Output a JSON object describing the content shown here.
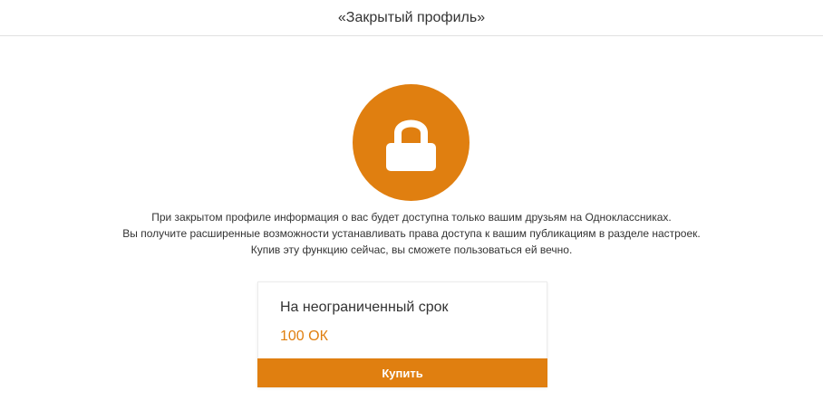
{
  "header": {
    "title": "«Закрытый профиль»"
  },
  "lock": {
    "icon": "lock-icon",
    "color": "#e07f10"
  },
  "description": {
    "lines": [
      "При закрытом профиле информация о вас будет доступна только вашим друзьям на Одноклассниках.",
      "Вы получите расширенные возможности устанавливать права доступа к вашим публикациям в разделе настроек.",
      "Купив эту функцию сейчас, вы сможете пользоваться ей вечно."
    ]
  },
  "offer": {
    "term": "На неограниченный срок",
    "price": "100 ОК",
    "buy_label": "Купить",
    "accent_color": "#e07f10"
  }
}
